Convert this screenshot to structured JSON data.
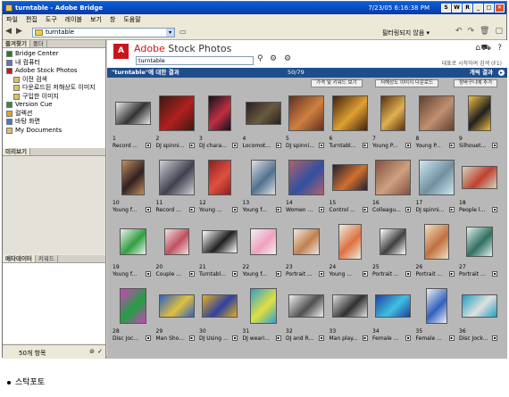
{
  "window": {
    "title": "turntable - Adobe Bridge",
    "clock": "7/23/05 6:16:38 PM"
  },
  "menu": [
    "파일",
    "편집",
    "도구",
    "레이블",
    "보기",
    "창",
    "도움말"
  ],
  "path": {
    "value": "turntable",
    "filter_label": "필터링되지 않음 ▾"
  },
  "left": {
    "tabs_top": [
      "즐겨찾기",
      "폴더"
    ],
    "favorites": [
      {
        "label": "Bridge Center",
        "sub": false,
        "color": "#2a7a2a"
      },
      {
        "label": "내 컴퓨터",
        "sub": false,
        "color": "#5a7ab0"
      },
      {
        "label": "Adobe Stock Photos",
        "sub": false,
        "color": "#c8161d"
      },
      {
        "label": "이전 검색",
        "sub": true,
        "color": "#e0c060"
      },
      {
        "label": "다운로드된 저해상도 이미지",
        "sub": true,
        "color": "#e0c060"
      },
      {
        "label": "구입한 이미지",
        "sub": true,
        "color": "#e0c060"
      },
      {
        "label": "Version Cue",
        "sub": false,
        "color": "#3a8a3a"
      },
      {
        "label": "컬렉션",
        "sub": false,
        "color": "#e0a030"
      },
      {
        "label": "바탕 화면",
        "sub": false,
        "color": "#4a7ac0"
      },
      {
        "label": "My Documents",
        "sub": false,
        "color": "#e0c060"
      }
    ],
    "preview_tab": "미리보기",
    "meta_tabs": [
      "메타데이터",
      "키워드"
    ],
    "status": "50개 항목"
  },
  "asp": {
    "logo_letter": "A",
    "brand": "Adobe",
    "brand2": "Stock Photos",
    "search_value": "turntable",
    "help": "대표로 시작하여 검색 (F1)",
    "results_label": "\"turntable\"에 대한 결과",
    "count": "50/79",
    "next": "개씩 결과",
    "buttons": [
      "가격 및 키워드 보기",
      "저해상도 이미지 다운로드",
      "장바구니에 추가"
    ]
  },
  "items": [
    {
      "num": "1",
      "name": "Record ...",
      "c": "#e8e8e8",
      "c2": "#333",
      "w": 40,
      "h": 26
    },
    {
      "num": "2",
      "name": "DJ spinni...",
      "c": "#3a1a10",
      "c2": "#b02020",
      "w": 40,
      "h": 40
    },
    {
      "num": "3",
      "name": "DJ chara...",
      "c": "#101020",
      "c2": "#c03040",
      "w": 26,
      "h": 40
    },
    {
      "num": "4",
      "name": "Locomot...",
      "c": "#2a2020",
      "c2": "#6a5a40",
      "w": 40,
      "h": 26
    },
    {
      "num": "5",
      "name": "DJ spinni...",
      "c": "#603020",
      "c2": "#d08040",
      "w": 40,
      "h": 40
    },
    {
      "num": "6",
      "name": "Turntabl...",
      "c": "#402010",
      "c2": "#e0a030",
      "w": 40,
      "h": 40
    },
    {
      "num": "7",
      "name": "Young P...",
      "c": "#5a3010",
      "c2": "#e0b050",
      "w": 28,
      "h": 40
    },
    {
      "num": "8",
      "name": "Young P...",
      "c": "#604030",
      "c2": "#c09070",
      "w": 40,
      "h": 40
    },
    {
      "num": "9",
      "name": "Silhouet...",
      "c": "#f0c040",
      "c2": "#202020",
      "w": 26,
      "h": 40
    },
    {
      "num": "10",
      "name": "Young f...",
      "c": "#c09060",
      "c2": "#302020",
      "w": 26,
      "h": 40
    },
    {
      "num": "11",
      "name": "Record ...",
      "c": "#d0d0d8",
      "c2": "#404050",
      "w": 40,
      "h": 40
    },
    {
      "num": "12",
      "name": "Young ...",
      "c": "#8a2020",
      "c2": "#e05040",
      "w": 26,
      "h": 40
    },
    {
      "num": "13",
      "name": "Young f...",
      "c": "#e0e0e0",
      "c2": "#507090",
      "w": 28,
      "h": 40
    },
    {
      "num": "14",
      "name": "Women ...",
      "c": "#b06070",
      "c2": "#3050a0",
      "w": 40,
      "h": 40
    },
    {
      "num": "15",
      "name": "Control ...",
      "c": "#202030",
      "c2": "#d07030",
      "w": 40,
      "h": 30
    },
    {
      "num": "16",
      "name": "Colleagu...",
      "c": "#805040",
      "c2": "#d0a080",
      "w": 40,
      "h": 40
    },
    {
      "num": "17",
      "name": "DJ spinni...",
      "c": "#d0e8f0",
      "c2": "#7090a0",
      "w": 40,
      "h": 40
    },
    {
      "num": "18",
      "name": "People l...",
      "c": "#d0d8c0",
      "c2": "#c04030",
      "w": 40,
      "h": 26
    },
    {
      "num": "19",
      "name": "Young f...",
      "c": "#f0f0f0",
      "c2": "#30a040",
      "w": 30,
      "h": 30
    },
    {
      "num": "20",
      "name": "Couple ...",
      "c": "#f0e0e0",
      "c2": "#c05060",
      "w": 28,
      "h": 30
    },
    {
      "num": "21",
      "name": "Turntabl...",
      "c": "#ffffff",
      "c2": "#202020",
      "w": 40,
      "h": 26
    },
    {
      "num": "22",
      "name": "Young f...",
      "c": "#f0f0f0",
      "c2": "#f0a0c0",
      "w": 30,
      "h": 30
    },
    {
      "num": "23",
      "name": "Portrait ...",
      "c": "#f0e8e0",
      "c2": "#c08050",
      "w": 30,
      "h": 30
    },
    {
      "num": "24",
      "name": "Young ...",
      "c": "#e8f0e0",
      "c2": "#e07040",
      "w": 26,
      "h": 40
    },
    {
      "num": "25",
      "name": "Portrait ...",
      "c": "#ffffff",
      "c2": "#404040",
      "w": 30,
      "h": 30
    },
    {
      "num": "26",
      "name": "Portrait ...",
      "c": "#f0e0c0",
      "c2": "#c07040",
      "w": 28,
      "h": 40
    },
    {
      "num": "27",
      "name": "Portrait ...",
      "c": "#e0f0f0",
      "c2": "#307060",
      "w": 30,
      "h": 34
    },
    {
      "num": "28",
      "name": "Disc Joc...",
      "c": "#d040c0",
      "c2": "#20a040",
      "w": 30,
      "h": 40
    },
    {
      "num": "29",
      "name": "Man Sho...",
      "c": "#3060c0",
      "c2": "#e0c040",
      "w": 40,
      "h": 26
    },
    {
      "num": "30",
      "name": "DJ Using ...",
      "c": "#e0b020",
      "c2": "#3040a0",
      "w": 40,
      "h": 26
    },
    {
      "num": "31",
      "name": "DJ weari...",
      "c": "#30a0d0",
      "c2": "#e0e040",
      "w": 30,
      "h": 40
    },
    {
      "num": "32",
      "name": "DJ and R...",
      "c": "#f0f0f0",
      "c2": "#505050",
      "w": 40,
      "h": 26
    },
    {
      "num": "33",
      "name": "Man play...",
      "c": "#e0e0e0",
      "c2": "#303030",
      "w": 40,
      "h": 26
    },
    {
      "num": "34",
      "name": "Female ...",
      "c": "#2040a0",
      "c2": "#40c0e0",
      "w": 40,
      "h": 26
    },
    {
      "num": "35",
      "name": "Female ...",
      "c": "#f0f0f0",
      "c2": "#3060c0",
      "w": 24,
      "h": 40
    },
    {
      "num": "36",
      "name": "Disc Jock...",
      "c": "#20a0c0",
      "c2": "#e0e0e0",
      "w": 40,
      "h": 26
    }
  ],
  "caption": "스탁포토"
}
